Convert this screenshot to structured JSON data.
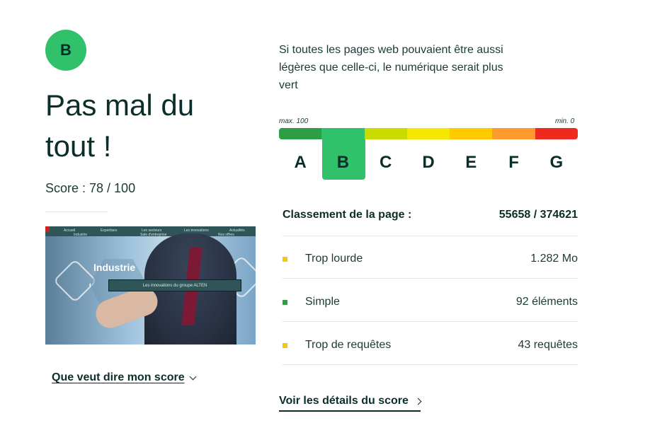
{
  "result": {
    "grade": "B",
    "verdict": "Pas mal du tout !",
    "score_text": "Score : 78 / 100",
    "score_value": 78,
    "score_max": 100,
    "meaning_link": "Que veut dire mon score"
  },
  "screenshot": {
    "nav_items": [
      "Accueil",
      "Expertises",
      "Les secteurs",
      "Les innovations",
      "Actualités"
    ],
    "sub_items": [
      "Industrie",
      "Sale d'entreprise",
      "Nos offres"
    ],
    "hero_title": "Industrie",
    "banner_text": "Les innovations du groupe ALTEN"
  },
  "summary": {
    "tagline": "Si toutes les pages web pouvaient être aussi légères que celle-ci, le numérique serait plus vert",
    "scale_max_label": "max. 100",
    "scale_min_label": "min. 0"
  },
  "scale": {
    "selected": "B",
    "grades": [
      {
        "letter": "A",
        "color": "#2e9e46"
      },
      {
        "letter": "B",
        "color": "#31c16b"
      },
      {
        "letter": "C",
        "color": "#c8dc00"
      },
      {
        "letter": "D",
        "color": "#f5e800"
      },
      {
        "letter": "E",
        "color": "#ffcb00"
      },
      {
        "letter": "F",
        "color": "#ff9a2e"
      },
      {
        "letter": "G",
        "color": "#ee2a1f"
      }
    ]
  },
  "ranking": {
    "label": "Classement de la page :",
    "value": "55658 / 374621"
  },
  "metrics": [
    {
      "label": "Trop lourde",
      "value": "1.282 Mo",
      "status_color": "#f5c800"
    },
    {
      "label": "Simple",
      "value": "92 éléments",
      "status_color": "#2e9e46"
    },
    {
      "label": "Trop de requêtes",
      "value": "43 requêtes",
      "status_color": "#f5c800"
    }
  ],
  "details_link": "Voir les détails du score",
  "colors": {
    "text": "#0b2e2a",
    "accent": "#31c16b",
    "divider": "#e3e6e5"
  }
}
